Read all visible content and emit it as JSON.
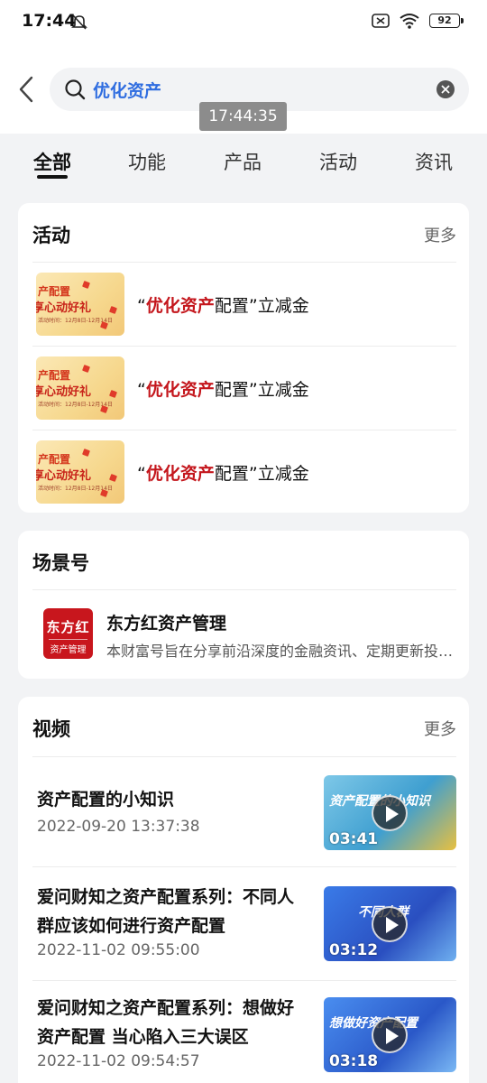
{
  "status_bar": {
    "time": "17:44",
    "battery": "92"
  },
  "search": {
    "query": "优化资产"
  },
  "overlay": {
    "timestamp": "17:44:35"
  },
  "tabs": [
    {
      "label": "全部"
    },
    {
      "label": "功能"
    },
    {
      "label": "产品"
    },
    {
      "label": "活动"
    },
    {
      "label": "资讯"
    }
  ],
  "activities": {
    "title": "活动",
    "more": "更多",
    "thumb": {
      "line1": "产配置",
      "line2": "享心动好礼",
      "line3": "活动时间：12月8日-12月14日"
    },
    "items": [
      {
        "quote_open": "“",
        "highlight": "优化资产",
        "rest": "配置”立减金"
      },
      {
        "quote_open": "“",
        "highlight": "优化资产",
        "rest": "配置”立减金"
      },
      {
        "quote_open": "“",
        "highlight": "优化资产",
        "rest": "配置”立减金"
      }
    ]
  },
  "scene": {
    "title": "场景号",
    "logo_line1": "东方红",
    "logo_line2": "资产管理",
    "name": "东方红资产管理",
    "description": "本财富号旨在分享前沿深度的金融资讯、定期更新投资策略"
  },
  "videos": {
    "title": "视频",
    "more": "更多",
    "items": [
      {
        "title": "资产配置的小知识",
        "date": "2022-09-20 13:37:38",
        "duration": "03:41",
        "caption": "资产配置的小知识"
      },
      {
        "title": "爱问财知之资产配置系列：不同人群应该如何进行资产配置",
        "date": "2022-11-02 09:55:00",
        "duration": "03:12",
        "caption": "不同人群"
      },
      {
        "title": "爱问财知之资产配置系列：想做好资产配置 当心陷入三大误区",
        "date": "2022-11-02 09:54:57",
        "duration": "03:18",
        "caption": "想做好资产配置"
      }
    ]
  },
  "colors": {
    "accent_blue": "#2f6de0",
    "highlight_red": "#c4161c",
    "logo_red": "#c8161d"
  }
}
